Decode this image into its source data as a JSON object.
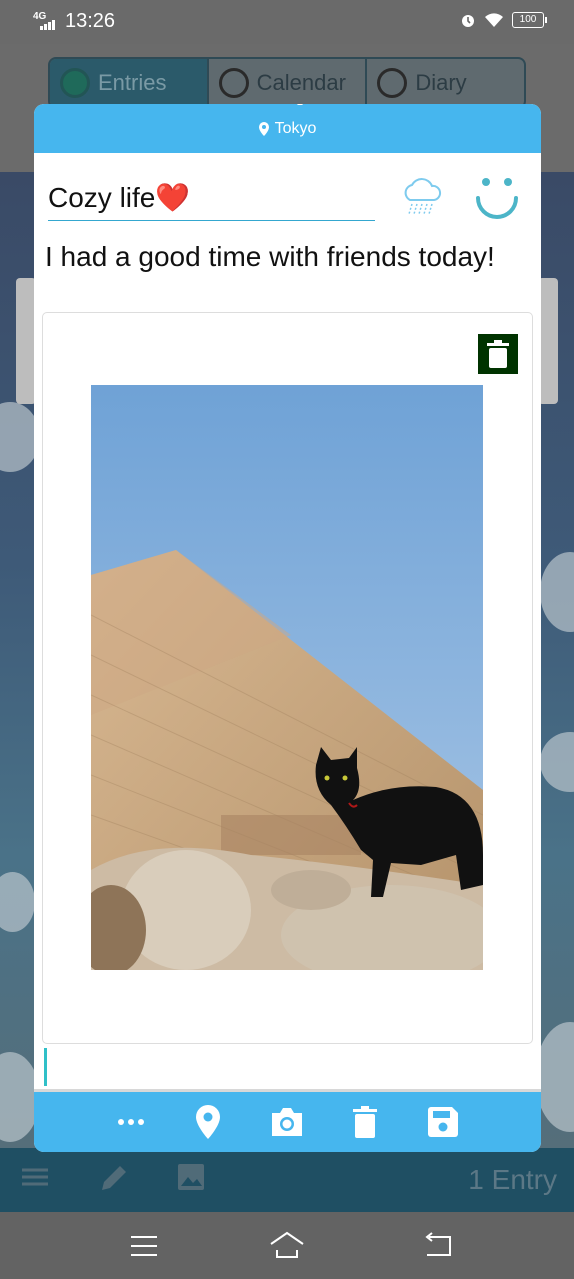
{
  "status_bar": {
    "network": "4G",
    "time": "13:26",
    "battery": "100"
  },
  "tabs": [
    {
      "label": "Entries",
      "selected": true
    },
    {
      "label": "Calendar",
      "selected": false
    },
    {
      "label": "Diary",
      "selected": false
    }
  ],
  "dialog": {
    "location": "Tokyo",
    "title": "Cozy life❤️",
    "body": "I had a good time with friends today!",
    "weather_icon": "rain-cloud-icon",
    "mood_icon": "smiley-icon",
    "photo_alt": "Black cat in front of a pyramid"
  },
  "toolbar": {
    "items": [
      "more-icon",
      "location-pin-icon",
      "camera-icon",
      "trash-icon",
      "save-icon"
    ]
  },
  "bottom_bar": {
    "entry_count": "1 Entry"
  },
  "colors": {
    "accent": "#46b6ee",
    "underline": "#34a7cf",
    "trash_bg": "#003300"
  }
}
